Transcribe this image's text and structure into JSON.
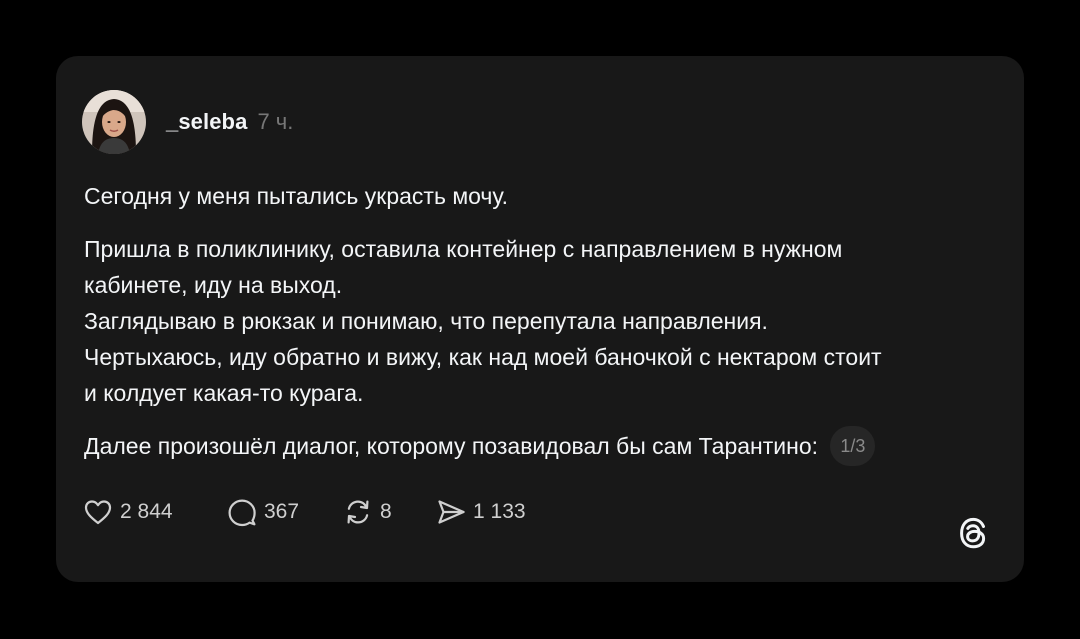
{
  "post": {
    "author": {
      "username": "_seleba",
      "time": "7 ч."
    },
    "paragraphs": [
      [
        "Сегодня у меня пытались украсть мочу."
      ],
      [
        "Пришла в поликлинику, оставила контейнер с направлением в нужном",
        "кабинете, иду на выход.",
        "Заглядываю в рюкзак и понимаю, что перепутала направления.",
        "Чертыхаюсь, иду обратно и вижу, как над моей баночкой с нектаром стоит",
        "и колдует какая-то курага."
      ],
      [
        "Далее произошёл диалог, которому позавидовал бы сам Тарантино:"
      ]
    ],
    "page_counter": "1/3",
    "stats": {
      "likes": "2 844",
      "replies": "367",
      "reposts": "8",
      "shares": "1 133"
    }
  },
  "icons": {
    "like": "heart-icon",
    "reply": "speech-bubble-icon",
    "repost": "repost-arrows-icon",
    "share": "send-icon",
    "brand": "threads-logo-icon"
  },
  "colors": {
    "background": "#000000",
    "card": "#181818",
    "text": "#f3f5f7",
    "muted": "#777777",
    "counter_bg": "#262626"
  }
}
